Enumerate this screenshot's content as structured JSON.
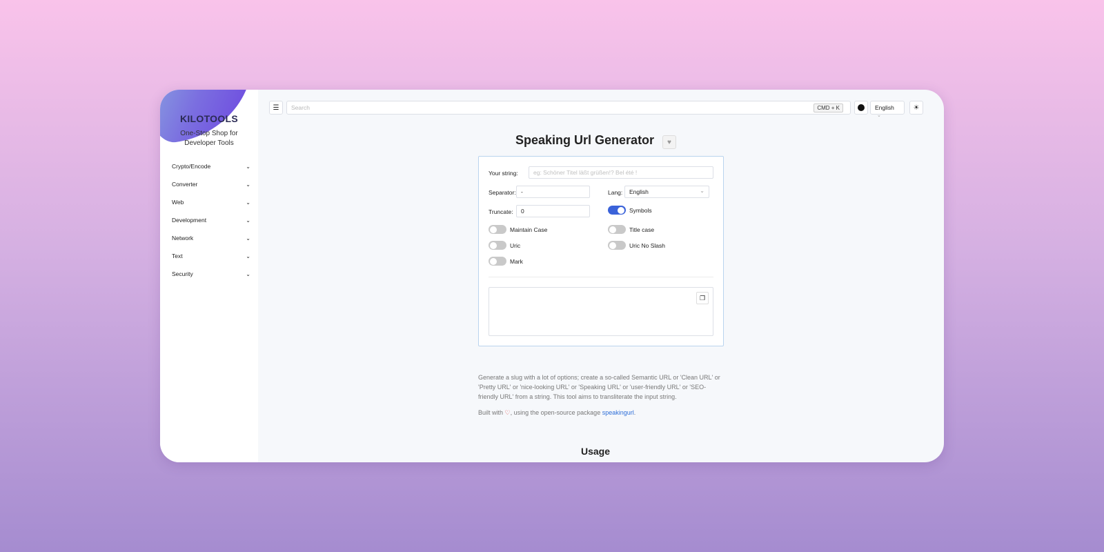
{
  "sidebar": {
    "logo_title": "KILOTOOLS",
    "logo_subtitle": "One-Stop Shop for Developer Tools",
    "items": [
      {
        "label": "Crypto/Encode"
      },
      {
        "label": "Converter"
      },
      {
        "label": "Web"
      },
      {
        "label": "Development"
      },
      {
        "label": "Network"
      },
      {
        "label": "Text"
      },
      {
        "label": "Security"
      }
    ]
  },
  "topbar": {
    "search_placeholder": "Search",
    "shortcut": "CMD + K",
    "language": "English"
  },
  "page": {
    "title": "Speaking Url Generator"
  },
  "form": {
    "string_label": "Your string:",
    "string_placeholder": "eg: Schöner Titel läßt grüßen!? Bel été !",
    "separator_label": "Separator:",
    "separator_value": "-",
    "lang_label": "Lang:",
    "lang_value": "English",
    "truncate_label": "Truncate:",
    "truncate_value": "0",
    "toggles": {
      "symbols": {
        "label": "Symbols",
        "on": true
      },
      "maintain_case": {
        "label": "Maintain Case",
        "on": false
      },
      "title_case": {
        "label": "Title case",
        "on": false
      },
      "uric": {
        "label": "Uric",
        "on": false
      },
      "uric_no_slash": {
        "label": "Uric No Slash",
        "on": false
      },
      "mark": {
        "label": "Mark",
        "on": false
      }
    }
  },
  "info": {
    "description": "Generate a slug with a lot of options; create a so-called Semantic URL or 'Clean URL' or 'Pretty URL' or 'nice-looking URL' or 'Speaking URL' or 'user-friendly URL' or 'SEO-friendly URL' from a string. This tool aims to transliterate the input string.",
    "built_prefix": "Built with",
    "built_middle": ", using the open-source package",
    "package_name": "speakingurl",
    "built_suffix": "."
  },
  "usage_title": "Usage",
  "colors": {
    "accent": "#3a62d9",
    "link": "#2f6fd8",
    "heart": "#e03a3a"
  }
}
